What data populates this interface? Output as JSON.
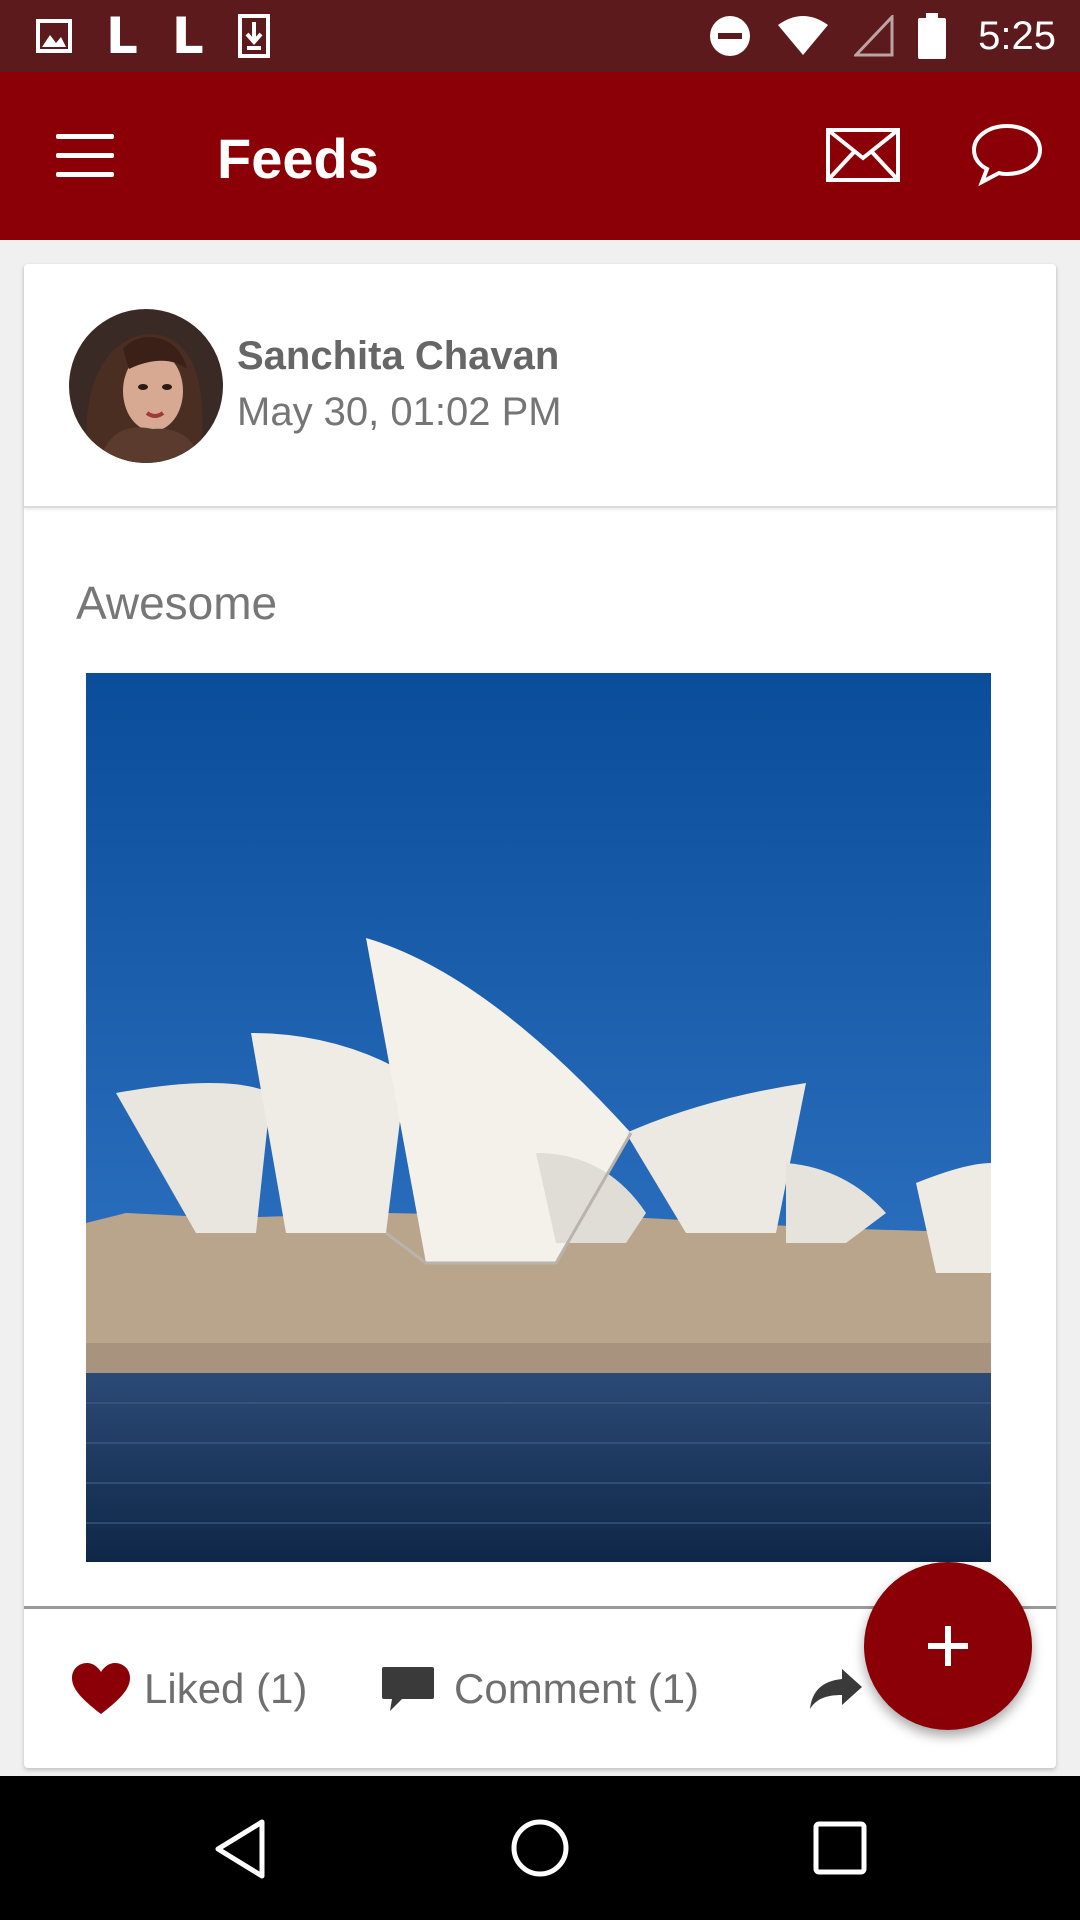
{
  "status_bar": {
    "left_icons": [
      "image-icon",
      "L",
      "L",
      "download-icon"
    ],
    "right_icons": [
      "do-not-disturb-icon",
      "wifi-icon",
      "signal-icon",
      "battery-icon"
    ],
    "time": "5:25",
    "background": "#5c1a1c"
  },
  "app_bar": {
    "title": "Feeds",
    "menu_icon": "hamburger-menu-icon",
    "actions": [
      "mail-icon",
      "chat-bubble-icon"
    ],
    "background": "#8b0007"
  },
  "post": {
    "author": "Sanchita Chavan",
    "date": "May 30, 01:02 PM",
    "text": "Awesome",
    "image_subject": "sydney-opera-house-photo",
    "actions": {
      "like_label": "Liked (1)",
      "comment_label": "Comment (1)",
      "share_icon": "share-icon"
    }
  },
  "fab": {
    "icon": "plus-icon",
    "color": "#8b0007"
  },
  "nav_bar": {
    "buttons": [
      "back-icon",
      "home-icon",
      "recents-icon"
    ]
  }
}
